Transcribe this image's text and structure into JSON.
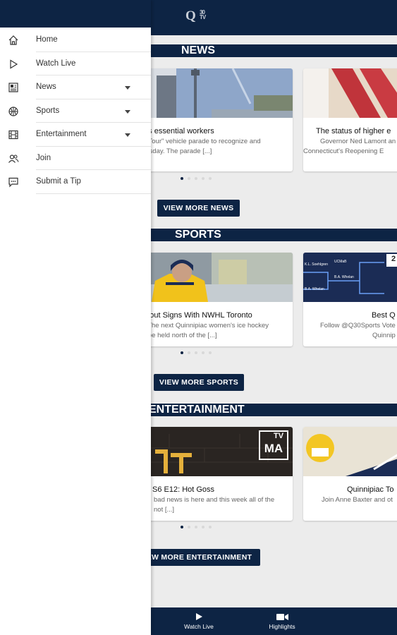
{
  "colors": {
    "navy": "#0d2444",
    "background": "#ececec",
    "accent_gold": "#e9b923"
  },
  "header": {
    "logo_letter": "Q",
    "logo_number": "30",
    "logo_tv": "TV"
  },
  "sections": {
    "news": {
      "title": "NEWS",
      "cards": [
        {
          "title": "nizes essential workers",
          "desc_line1": "You Tour\" vehicle parade to recognize and",
          "desc_line2": "Thursday. The parade [...]"
        },
        {
          "title": "The status of higher e",
          "desc_line1": "Governor Ned Lamont an",
          "desc_line2": "Connecticut's Reopening E"
        }
      ],
      "more_label": "VIEW MORE NEWS"
    },
    "sports": {
      "title": "SPORTS",
      "cards": [
        {
          "title": "dbout Signs With NWHL Toronto",
          "desc_line1": "s The next Quinnipiac women's ice hockey",
          "desc_line2": "o be held north of the [...]"
        },
        {
          "title": "Best Q",
          "desc_line1": "Follow @Q30Sports Vote",
          "desc_line2": "Quinnip",
          "bracket_labels": [
            "K.L. Soehlgren",
            "UCMaB",
            "B.A. Whelan",
            "B.A. Whelan"
          ],
          "corner_number": "2"
        }
      ],
      "more_label": "VIEW MORE SPORTS"
    },
    "entertainment": {
      "title": "ENTERTAINMENT",
      "cards": [
        {
          "title": "S6 E12: Hot Goss",
          "desc_line1": "bad news is here and this week all of the",
          "desc_line2": "not [...]",
          "rating_top": "TV",
          "rating_bottom": "MA"
        },
        {
          "title": "Quinnipiac To",
          "desc_line1": "Join Anne Baxter and ot",
          "desc_line2": ""
        }
      ],
      "more_label": "EW MORE ENTERTAINMENT"
    }
  },
  "bottom_nav": [
    {
      "label": "Watch Live",
      "icon": "play-icon"
    },
    {
      "label": "Highlights",
      "icon": "video-camera-icon"
    }
  ],
  "drawer": {
    "items": [
      {
        "label": "Home",
        "icon": "home-icon",
        "expandable": false
      },
      {
        "label": "Watch Live",
        "icon": "play-icon",
        "expandable": false
      },
      {
        "label": "News",
        "icon": "newspaper-icon",
        "expandable": true
      },
      {
        "label": "Sports",
        "icon": "sports-ball-icon",
        "expandable": true
      },
      {
        "label": "Entertainment",
        "icon": "film-icon",
        "expandable": true
      },
      {
        "label": "Join",
        "icon": "users-icon",
        "expandable": false
      },
      {
        "label": "Submit a Tip",
        "icon": "chat-bubble-icon",
        "expandable": false
      }
    ]
  }
}
